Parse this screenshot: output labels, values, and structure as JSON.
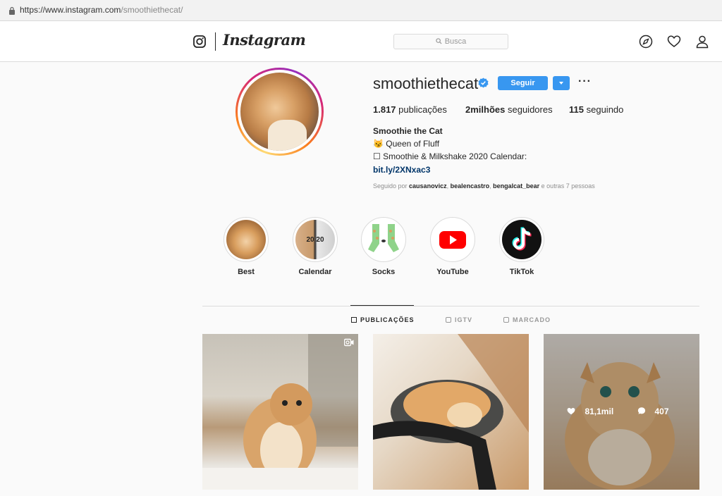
{
  "browser": {
    "url_host": "https://www.instagram.com",
    "url_path": "/smoothiethecat/"
  },
  "header": {
    "wordmark": "Instagram",
    "search_placeholder": "Busca"
  },
  "profile": {
    "username": "smoothiethecat",
    "follow_label": "Seguir",
    "more_label": "···",
    "stats": {
      "posts_count": "1.817",
      "posts_label": "publicações",
      "followers_count": "2milhões",
      "followers_label": "seguidores",
      "following_count": "115",
      "following_label": "seguindo"
    },
    "bio": {
      "name": "Smoothie the Cat",
      "line1": "😼 Queen of Fluff",
      "line2": "☐ Smoothie & Milkshake 2020 Calendar:",
      "link": "bit.ly/2XNxac3"
    },
    "followed_by": {
      "prefix": "Seguido por ",
      "user1": "causanovicz",
      "sep1": ", ",
      "user2": "bealencastro",
      "sep2": ", ",
      "user3": "bengalcat_bear",
      "suffix": " e outras 7 pessoas"
    }
  },
  "highlights": [
    {
      "label": "Best"
    },
    {
      "label": "Calendar",
      "img_text": "20 20"
    },
    {
      "label": "Socks"
    },
    {
      "label": "YouTube"
    },
    {
      "label": "TikTok"
    }
  ],
  "tabs": [
    {
      "label": "PUBLICAÇÕES"
    },
    {
      "label": "IGTV"
    },
    {
      "label": "MARCADO"
    }
  ],
  "posts": [
    {
      "type": "video"
    },
    {
      "type": "photo"
    },
    {
      "type": "photo",
      "likes": "81,1mil",
      "comments": "407"
    }
  ],
  "colors": {
    "accent": "#3897f0",
    "link": "#003569",
    "verified": "#3897f0"
  }
}
